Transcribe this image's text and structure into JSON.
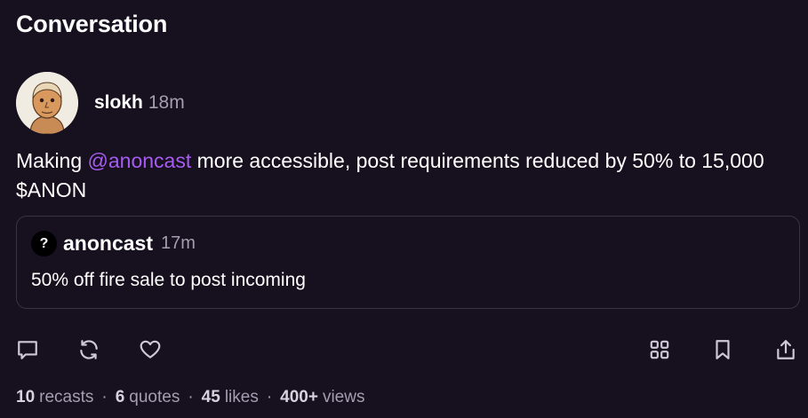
{
  "page": {
    "title": "Conversation"
  },
  "post": {
    "author": {
      "name": "slokh",
      "time": "18m"
    },
    "text": {
      "before": "Making ",
      "mention": "@anoncast",
      "after": " more accessible, post requirements reduced by 50% to 15,000 $ANON"
    },
    "quote": {
      "avatar_glyph": "?",
      "author": "anoncast",
      "time": "17m",
      "text": "50% off fire sale to post incoming"
    },
    "actions": {
      "left": [
        "reply-icon",
        "recast-icon",
        "like-icon"
      ],
      "right": [
        "grid-icon",
        "bookmark-icon",
        "share-icon"
      ]
    },
    "stats": {
      "recasts": {
        "value": "10",
        "label": "recasts"
      },
      "quotes": {
        "value": "6",
        "label": "quotes"
      },
      "likes": {
        "value": "45",
        "label": "likes"
      },
      "views": {
        "value": "400+",
        "label": "views"
      }
    },
    "colors": {
      "background": "#17101f",
      "mention": "#a65cf0",
      "muted": "#a59eb0"
    }
  }
}
